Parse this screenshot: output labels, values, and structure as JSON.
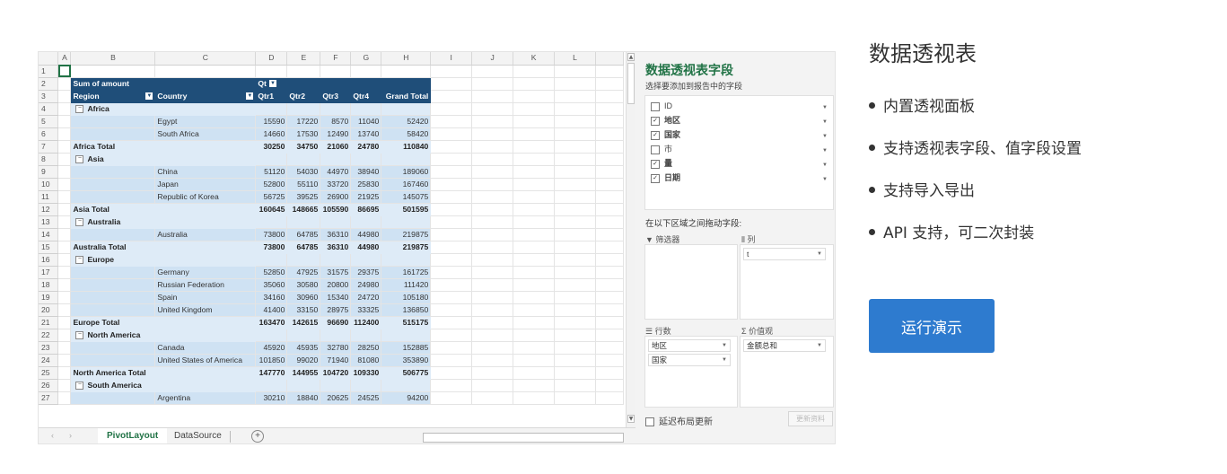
{
  "spreadsheet": {
    "columns": [
      "A",
      "B",
      "C",
      "D",
      "E",
      "F",
      "G",
      "H",
      "I",
      "J",
      "K",
      "L"
    ],
    "pivot_header": {
      "sum_label": "Sum of amount",
      "qt_label": "Qt",
      "region_label": "Region",
      "country_label": "Country",
      "quarters": [
        "Qtr1",
        "Qtr2",
        "Qtr3",
        "Qtr4"
      ],
      "grand_total_label": "Grand Total"
    },
    "rows": [
      {
        "type": "group",
        "region": "Africa"
      },
      {
        "type": "detail",
        "country": "Egypt",
        "values": [
          "15590",
          "17220",
          "8570",
          "11040",
          "52420"
        ]
      },
      {
        "type": "detail",
        "country": "South Africa",
        "values": [
          "14660",
          "17530",
          "12490",
          "13740",
          "58420"
        ]
      },
      {
        "type": "total",
        "label": "Africa Total",
        "values": [
          "30250",
          "34750",
          "21060",
          "24780",
          "110840"
        ]
      },
      {
        "type": "group",
        "region": "Asia"
      },
      {
        "type": "detail",
        "country": "China",
        "values": [
          "51120",
          "54030",
          "44970",
          "38940",
          "189060"
        ]
      },
      {
        "type": "detail",
        "country": "Japan",
        "values": [
          "52800",
          "55110",
          "33720",
          "25830",
          "167460"
        ]
      },
      {
        "type": "detail",
        "country": "Republic of Korea",
        "values": [
          "56725",
          "39525",
          "26900",
          "21925",
          "145075"
        ]
      },
      {
        "type": "total",
        "label": "Asia Total",
        "values": [
          "160645",
          "148665",
          "105590",
          "86695",
          "501595"
        ]
      },
      {
        "type": "group",
        "region": "Australia"
      },
      {
        "type": "detail",
        "country": "Australia",
        "values": [
          "73800",
          "64785",
          "36310",
          "44980",
          "219875"
        ]
      },
      {
        "type": "total",
        "label": "Australia Total",
        "values": [
          "73800",
          "64785",
          "36310",
          "44980",
          "219875"
        ]
      },
      {
        "type": "group",
        "region": "Europe"
      },
      {
        "type": "detail",
        "country": "Germany",
        "values": [
          "52850",
          "47925",
          "31575",
          "29375",
          "161725"
        ]
      },
      {
        "type": "detail",
        "country": "Russian Federation",
        "values": [
          "35060",
          "30580",
          "20800",
          "24980",
          "111420"
        ]
      },
      {
        "type": "detail",
        "country": "Spain",
        "values": [
          "34160",
          "30960",
          "15340",
          "24720",
          "105180"
        ]
      },
      {
        "type": "detail",
        "country": "United Kingdom",
        "values": [
          "41400",
          "33150",
          "28975",
          "33325",
          "136850"
        ]
      },
      {
        "type": "total",
        "label": "Europe Total",
        "values": [
          "163470",
          "142615",
          "96690",
          "112400",
          "515175"
        ]
      },
      {
        "type": "group",
        "region": "North America"
      },
      {
        "type": "detail",
        "country": "Canada",
        "values": [
          "45920",
          "45935",
          "32780",
          "28250",
          "152885"
        ]
      },
      {
        "type": "detail",
        "country": "United States of America",
        "values": [
          "101850",
          "99020",
          "71940",
          "81080",
          "353890"
        ]
      },
      {
        "type": "total",
        "label": "North America Total",
        "values": [
          "147770",
          "144955",
          "104720",
          "109330",
          "506775"
        ]
      },
      {
        "type": "group",
        "region": "South America"
      },
      {
        "type": "detail",
        "country": "Argentina",
        "values": [
          "30210",
          "18840",
          "20625",
          "24525",
          "94200"
        ]
      }
    ],
    "sheet_tabs": [
      "PivotLayout",
      "DataSource"
    ],
    "active_tab": "PivotLayout"
  },
  "field_panel": {
    "title": "数据透视表字段",
    "subtitle": "选择要添加到报告中的字段",
    "fields": [
      {
        "name": "ID",
        "checked": false
      },
      {
        "name": "地区",
        "checked": true
      },
      {
        "name": "国家",
        "checked": true
      },
      {
        "name": "市",
        "checked": false
      },
      {
        "name": "量",
        "checked": true
      },
      {
        "name": "日期",
        "checked": true
      }
    ],
    "areas_label": "在以下区域之间拖动字段:",
    "filters_label": "筛选器",
    "columns_label": "列",
    "rows_label": "行数",
    "values_label": "价值观",
    "column_chips": [
      "t"
    ],
    "row_chips": [
      "地区",
      "国家"
    ],
    "value_chips": [
      "金额总和"
    ],
    "defer_label": "延迟布局更新",
    "update_label": "更新资料"
  },
  "info": {
    "heading": "数据透视表",
    "features": [
      "内置透视面板",
      "支持透视表字段、值字段设置",
      "支持导入导出",
      "API 支持，可二次封装"
    ],
    "run_label": "运行演示"
  }
}
